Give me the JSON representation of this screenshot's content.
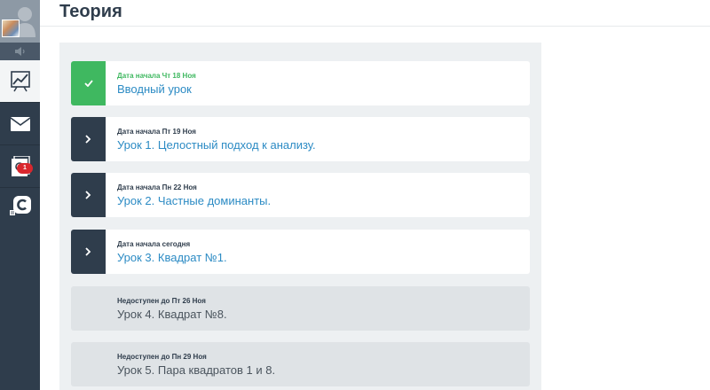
{
  "page": {
    "title": "Теория"
  },
  "sidebar": {
    "badge_count": "1",
    "items": [
      {
        "name": "stats",
        "icon": "chart-icon",
        "active": true
      },
      {
        "name": "mail",
        "icon": "envelope-icon",
        "active": false
      },
      {
        "name": "docs",
        "icon": "documents-icon",
        "active": false
      },
      {
        "name": "chat",
        "icon": "chat-c-icon",
        "active": false
      }
    ]
  },
  "lessons": [
    {
      "meta": "Дата начала Чт 18 Ноя",
      "title": "Вводный урок",
      "state": "done"
    },
    {
      "meta": "Дата начала Пт 19 Ноя",
      "title": "Урок 1. Целостный подход к анализу.",
      "state": "open"
    },
    {
      "meta": "Дата начала Пн 22 Ноя",
      "title": "Урок 2. Частные доминанты.",
      "state": "open"
    },
    {
      "meta": "Дата начала сегодня",
      "title": "Урок 3. Квадрат №1.",
      "state": "open"
    },
    {
      "meta": "Недоступен до Пт 26 Ноя",
      "title": "Урок 4. Квадрат №8.",
      "state": "locked"
    },
    {
      "meta": "Недоступен до Пн 29 Ноя",
      "title": "Урок 5. Пара квадратов 1 и 8.",
      "state": "locked"
    }
  ],
  "colors": {
    "sidebar": "#2f3d4c",
    "done": "#3fb860",
    "link": "#2c8bc4",
    "badge": "#d9272e"
  }
}
